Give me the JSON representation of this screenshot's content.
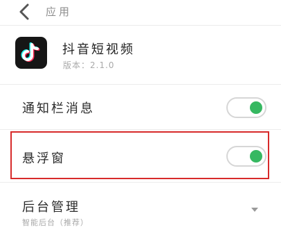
{
  "header": {
    "title": "应用",
    "back_icon": "chevron-left-icon"
  },
  "app": {
    "name": "抖音短视频",
    "version": "版本：2.1.0",
    "icon": "tiktok-logo"
  },
  "settings": {
    "notify": {
      "label": "通知栏消息",
      "enabled": true
    },
    "floating_window": {
      "label": "悬浮窗",
      "enabled": true,
      "highlighted": true
    },
    "background": {
      "label": "后台管理",
      "value": "智能后台（推荐）",
      "dropdown_icon": "triangle-down-icon"
    }
  },
  "colors": {
    "toggle_on": "#36b861",
    "highlight": "#d72a2a",
    "app_icon_bg": "#161616",
    "tiktok_cyan": "#25f4ee",
    "tiktok_red": "#fe2c55"
  }
}
